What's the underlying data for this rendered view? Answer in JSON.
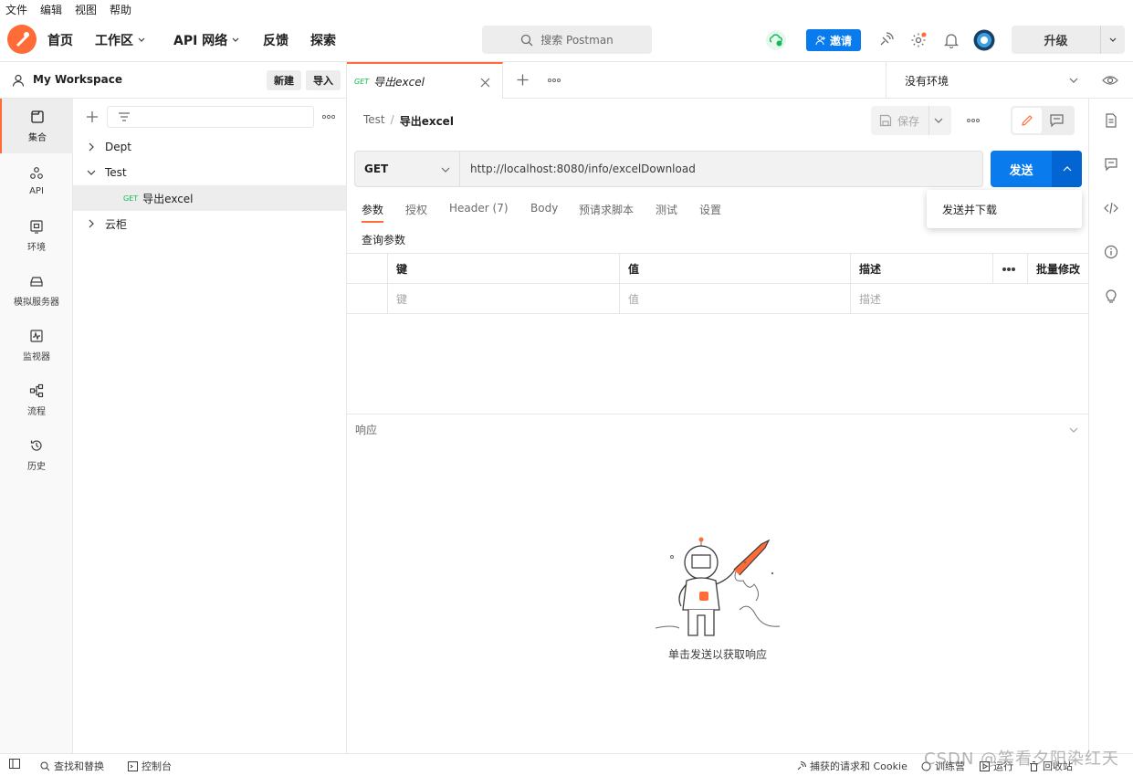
{
  "menubar": {
    "items": [
      "文件",
      "编辑",
      "视图",
      "帮助"
    ]
  },
  "header": {
    "nav": {
      "home": "首页",
      "workspace": "工作区",
      "api_network": "API 网络",
      "feedback": "反馈",
      "explore": "探索"
    },
    "search_placeholder": "搜索 Postman",
    "invite": "邀请",
    "upgrade": "升级"
  },
  "workspace": {
    "title": "My Workspace",
    "new_btn": "新建",
    "import_btn": "导入"
  },
  "rail": {
    "items": [
      "集合",
      "API",
      "环境",
      "模拟服务器",
      "监视器",
      "流程",
      "历史"
    ]
  },
  "collections": {
    "tree": [
      {
        "label": "Dept"
      },
      {
        "label": "Test"
      },
      {
        "method": "GET",
        "label": "导出excel"
      },
      {
        "label": "云柜"
      }
    ]
  },
  "tabs": {
    "active": {
      "method": "GET",
      "label": "导出excel"
    },
    "environment": "没有环境"
  },
  "request": {
    "breadcrumb": {
      "collection": "Test",
      "separator": "/",
      "name": "导出excel"
    },
    "save": "保存",
    "method": "GET",
    "url": "http://localhost:8080/info/excelDownload",
    "send": "发送",
    "send_menu": "发送并下载",
    "tabs": [
      "参数",
      "授权",
      "Header (7)",
      "Body",
      "预请求脚本",
      "测试",
      "设置"
    ],
    "params_title": "查询参数",
    "table": {
      "headers": {
        "key": "键",
        "value": "值",
        "desc": "描述",
        "bulk": "批量修改"
      },
      "placeholders": {
        "key": "键",
        "value": "值",
        "desc": "描述"
      }
    }
  },
  "response": {
    "title": "响应",
    "empty_message": "单击发送以获取响应"
  },
  "statusbar": {
    "find_replace": "查找和替换",
    "console": "控制台",
    "capture": "捕获的请求和 Cookie",
    "bootcamp": "训练营",
    "runner": "运行",
    "trash": "回收站"
  },
  "watermark": "CSDN @笑看夕阳染红天",
  "colors": {
    "brand": "#ff6c37",
    "primary": "#097bed",
    "get": "#0cbb52"
  }
}
